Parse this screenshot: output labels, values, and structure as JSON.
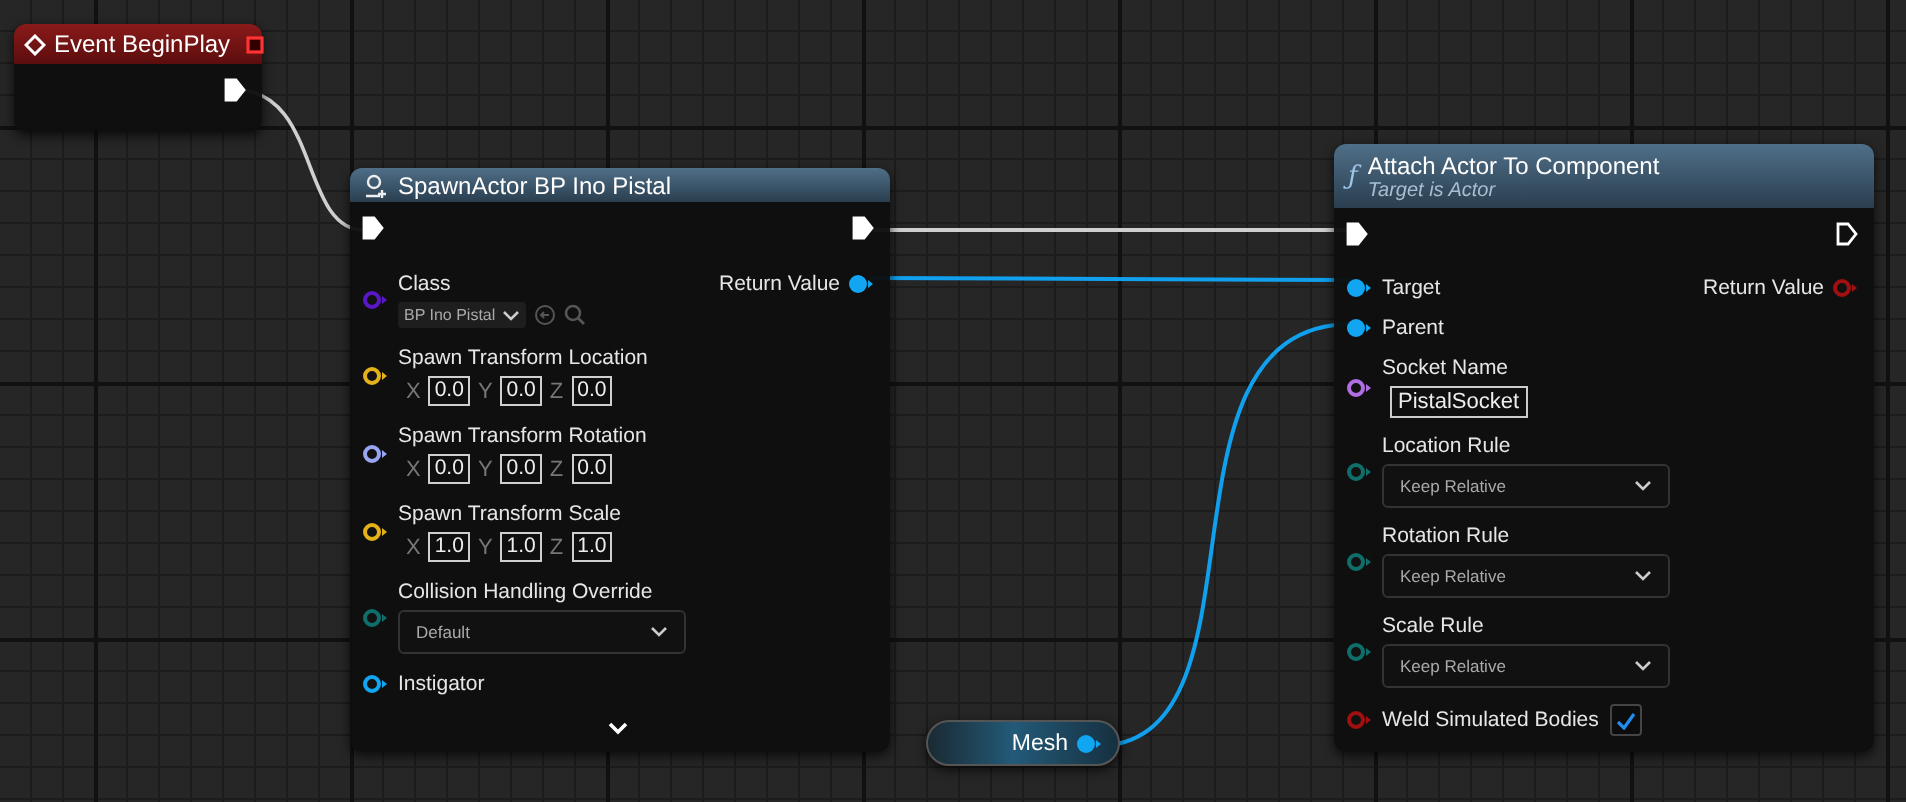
{
  "nodes": [
    {
      "kind": "event",
      "title": "Event BeginPlay",
      "rows": [
        {
          "right": {
            "kind": "exec",
            "connected": true
          }
        }
      ]
    },
    {
      "kind": "function",
      "title": "SpawnActor BP Ino Pistal",
      "expandable": true,
      "rows": [
        {
          "left": {
            "kind": "exec",
            "connected": true
          },
          "right": {
            "kind": "exec",
            "connected": true
          }
        },
        {
          "left": {
            "kind": "data",
            "label": "Class",
            "color": "#5a17c8",
            "connected": false,
            "widget": {
              "kind": "class",
              "value": "BP Ino Pistal"
            }
          },
          "right": {
            "kind": "data",
            "label": "Return Value",
            "color": "#12a6f2",
            "connected": true
          }
        },
        {
          "left": {
            "kind": "data",
            "label": "Spawn Transform Location",
            "color": "#e3b21a",
            "connected": false,
            "widget": {
              "kind": "vector",
              "fields": [
                {
                  "axis": "X",
                  "value": "0.0"
                },
                {
                  "axis": "Y",
                  "value": "0.0"
                },
                {
                  "axis": "Z",
                  "value": "0.0"
                }
              ]
            }
          }
        },
        {
          "left": {
            "kind": "data",
            "label": "Spawn Transform Rotation",
            "color": "#98a6f2",
            "connected": false,
            "widget": {
              "kind": "vector",
              "fields": [
                {
                  "axis": "X",
                  "value": "0.0"
                },
                {
                  "axis": "Y",
                  "value": "0.0"
                },
                {
                  "axis": "Z",
                  "value": "0.0"
                }
              ]
            }
          }
        },
        {
          "left": {
            "kind": "data",
            "label": "Spawn Transform Scale",
            "color": "#e3b21a",
            "connected": false,
            "widget": {
              "kind": "vector",
              "fields": [
                {
                  "axis": "X",
                  "value": "1.0"
                },
                {
                  "axis": "Y",
                  "value": "1.0"
                },
                {
                  "axis": "Z",
                  "value": "1.0"
                }
              ]
            }
          }
        },
        {
          "left": {
            "kind": "data",
            "label": "Collision Handling Override",
            "color": "#0f6e6a",
            "connected": false,
            "widget": {
              "kind": "dropdown",
              "value": "Default"
            }
          }
        },
        {
          "left": {
            "kind": "data",
            "label": "Instigator",
            "color": "#12a6f2",
            "connected": false
          }
        }
      ]
    },
    {
      "kind": "function",
      "glyph": "ƒ",
      "title": "Attach Actor To Component",
      "subtitle": "Target is Actor",
      "rows": [
        {
          "left": {
            "kind": "exec",
            "connected": true
          },
          "right": {
            "kind": "exec",
            "connected": false
          }
        },
        {
          "left": {
            "kind": "data",
            "label": "Target",
            "color": "#12a6f2",
            "connected": true
          },
          "right": {
            "kind": "data",
            "label": "Return Value",
            "color": "#a01010",
            "connected": false
          }
        },
        {
          "left": {
            "kind": "data",
            "label": "Parent",
            "color": "#12a6f2",
            "connected": true
          }
        },
        {
          "left": {
            "kind": "data",
            "label": "Socket Name",
            "color": "#b06ee0",
            "connected": false,
            "widget": {
              "kind": "text",
              "value": "PistalSocket"
            }
          }
        },
        {
          "left": {
            "kind": "data",
            "label": "Location Rule",
            "color": "#0f6e6a",
            "connected": false,
            "widget": {
              "kind": "dropdown",
              "value": "Keep Relative"
            }
          }
        },
        {
          "left": {
            "kind": "data",
            "label": "Rotation Rule",
            "color": "#0f6e6a",
            "connected": false,
            "widget": {
              "kind": "dropdown",
              "value": "Keep Relative"
            }
          }
        },
        {
          "left": {
            "kind": "data",
            "label": "Scale Rule",
            "color": "#0f6e6a",
            "connected": false,
            "widget": {
              "kind": "dropdown",
              "value": "Keep Relative"
            }
          }
        },
        {
          "left": {
            "kind": "data",
            "label": "Weld Simulated Bodies",
            "color": "#a01010",
            "connected": false,
            "widget": {
              "kind": "checkbox",
              "checked": true
            }
          }
        }
      ]
    },
    {
      "kind": "variable",
      "title": "Mesh",
      "rows": [
        {
          "right": {
            "kind": "data",
            "color": "#12a6f2",
            "connected": true
          }
        }
      ]
    }
  ]
}
